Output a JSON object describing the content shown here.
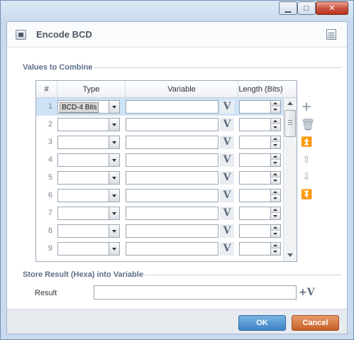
{
  "window": {
    "title": "Encode BCD"
  },
  "titlebar_buttons": {
    "minimize": "▁",
    "maximize": "□",
    "close": "✕"
  },
  "values_section": {
    "title": "Values to Combine"
  },
  "grid": {
    "columns": [
      "#",
      "Type",
      "Variable",
      "Length (Bits)"
    ],
    "rows": [
      {
        "num": "1",
        "type": "BCD-4 Bits",
        "selected": true
      },
      {
        "num": "2",
        "type": ""
      },
      {
        "num": "3",
        "type": ""
      },
      {
        "num": "4",
        "type": ""
      },
      {
        "num": "5",
        "type": ""
      },
      {
        "num": "6",
        "type": ""
      },
      {
        "num": "7",
        "type": ""
      },
      {
        "num": "8",
        "type": ""
      },
      {
        "num": "9",
        "type": ""
      }
    ],
    "variable_button_glyph": "V"
  },
  "side_tools": [
    "add-icon",
    "delete-icon",
    "move-top-icon",
    "move-up-icon",
    "move-down-icon",
    "move-bottom-icon"
  ],
  "result_section": {
    "title": "Store Result (Hexa) into Variable",
    "label": "Result",
    "variable_button_glyph": "+V"
  },
  "footer": {
    "ok_label": "OK",
    "cancel_label": "Cancel"
  },
  "colors": {
    "ok": "#3e82c3",
    "cancel": "#c9602a",
    "selected_row": "#cfe3f7"
  }
}
